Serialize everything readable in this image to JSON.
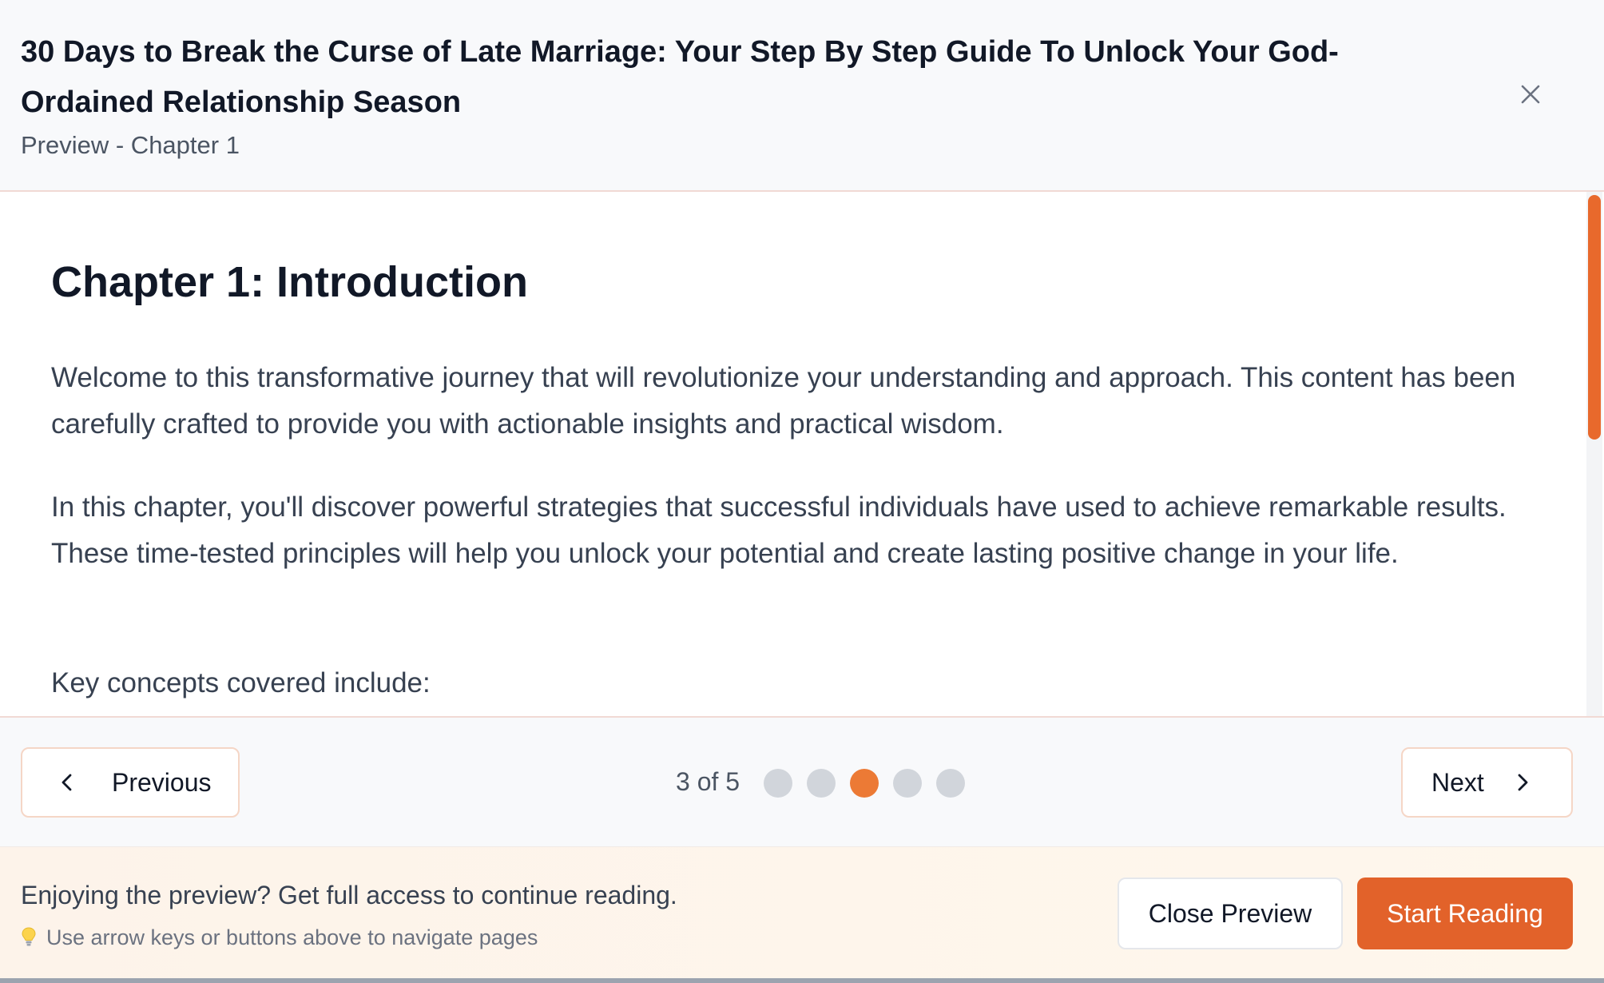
{
  "header": {
    "title": "30 Days to Break the Curse of Late Marriage: Your Step By Step Guide To Unlock Your God-Ordained Relationship Season",
    "subtitle": "Preview - Chapter 1",
    "close_icon": "close-icon"
  },
  "content": {
    "chapter_title": "Chapter 1: Introduction",
    "paragraphs": [
      "Welcome to this transformative journey that will revolutionize your understanding and approach. This content has been carefully crafted to provide you with actionable insights and practical wisdom.",
      "In this chapter, you'll discover powerful strategies that successful individuals have used to achieve remarkable results. These time-tested principles will help you unlock your potential and create lasting positive change in your life.",
      "Key concepts covered include:"
    ]
  },
  "pager": {
    "previous_label": "Previous",
    "next_label": "Next",
    "page_indicator": "3 of 5",
    "current_page": 3,
    "total_pages": 5
  },
  "footer": {
    "message": "Enjoying the preview? Get full access to continue reading.",
    "hint": "Use arrow keys or buttons above to navigate pages",
    "hint_icon": "lightbulb-icon",
    "close_preview_label": "Close Preview",
    "start_reading_label": "Start Reading"
  },
  "colors": {
    "accent": "#e2622a",
    "active_dot": "#ec7a35",
    "inactive_dot": "#d1d5db"
  }
}
